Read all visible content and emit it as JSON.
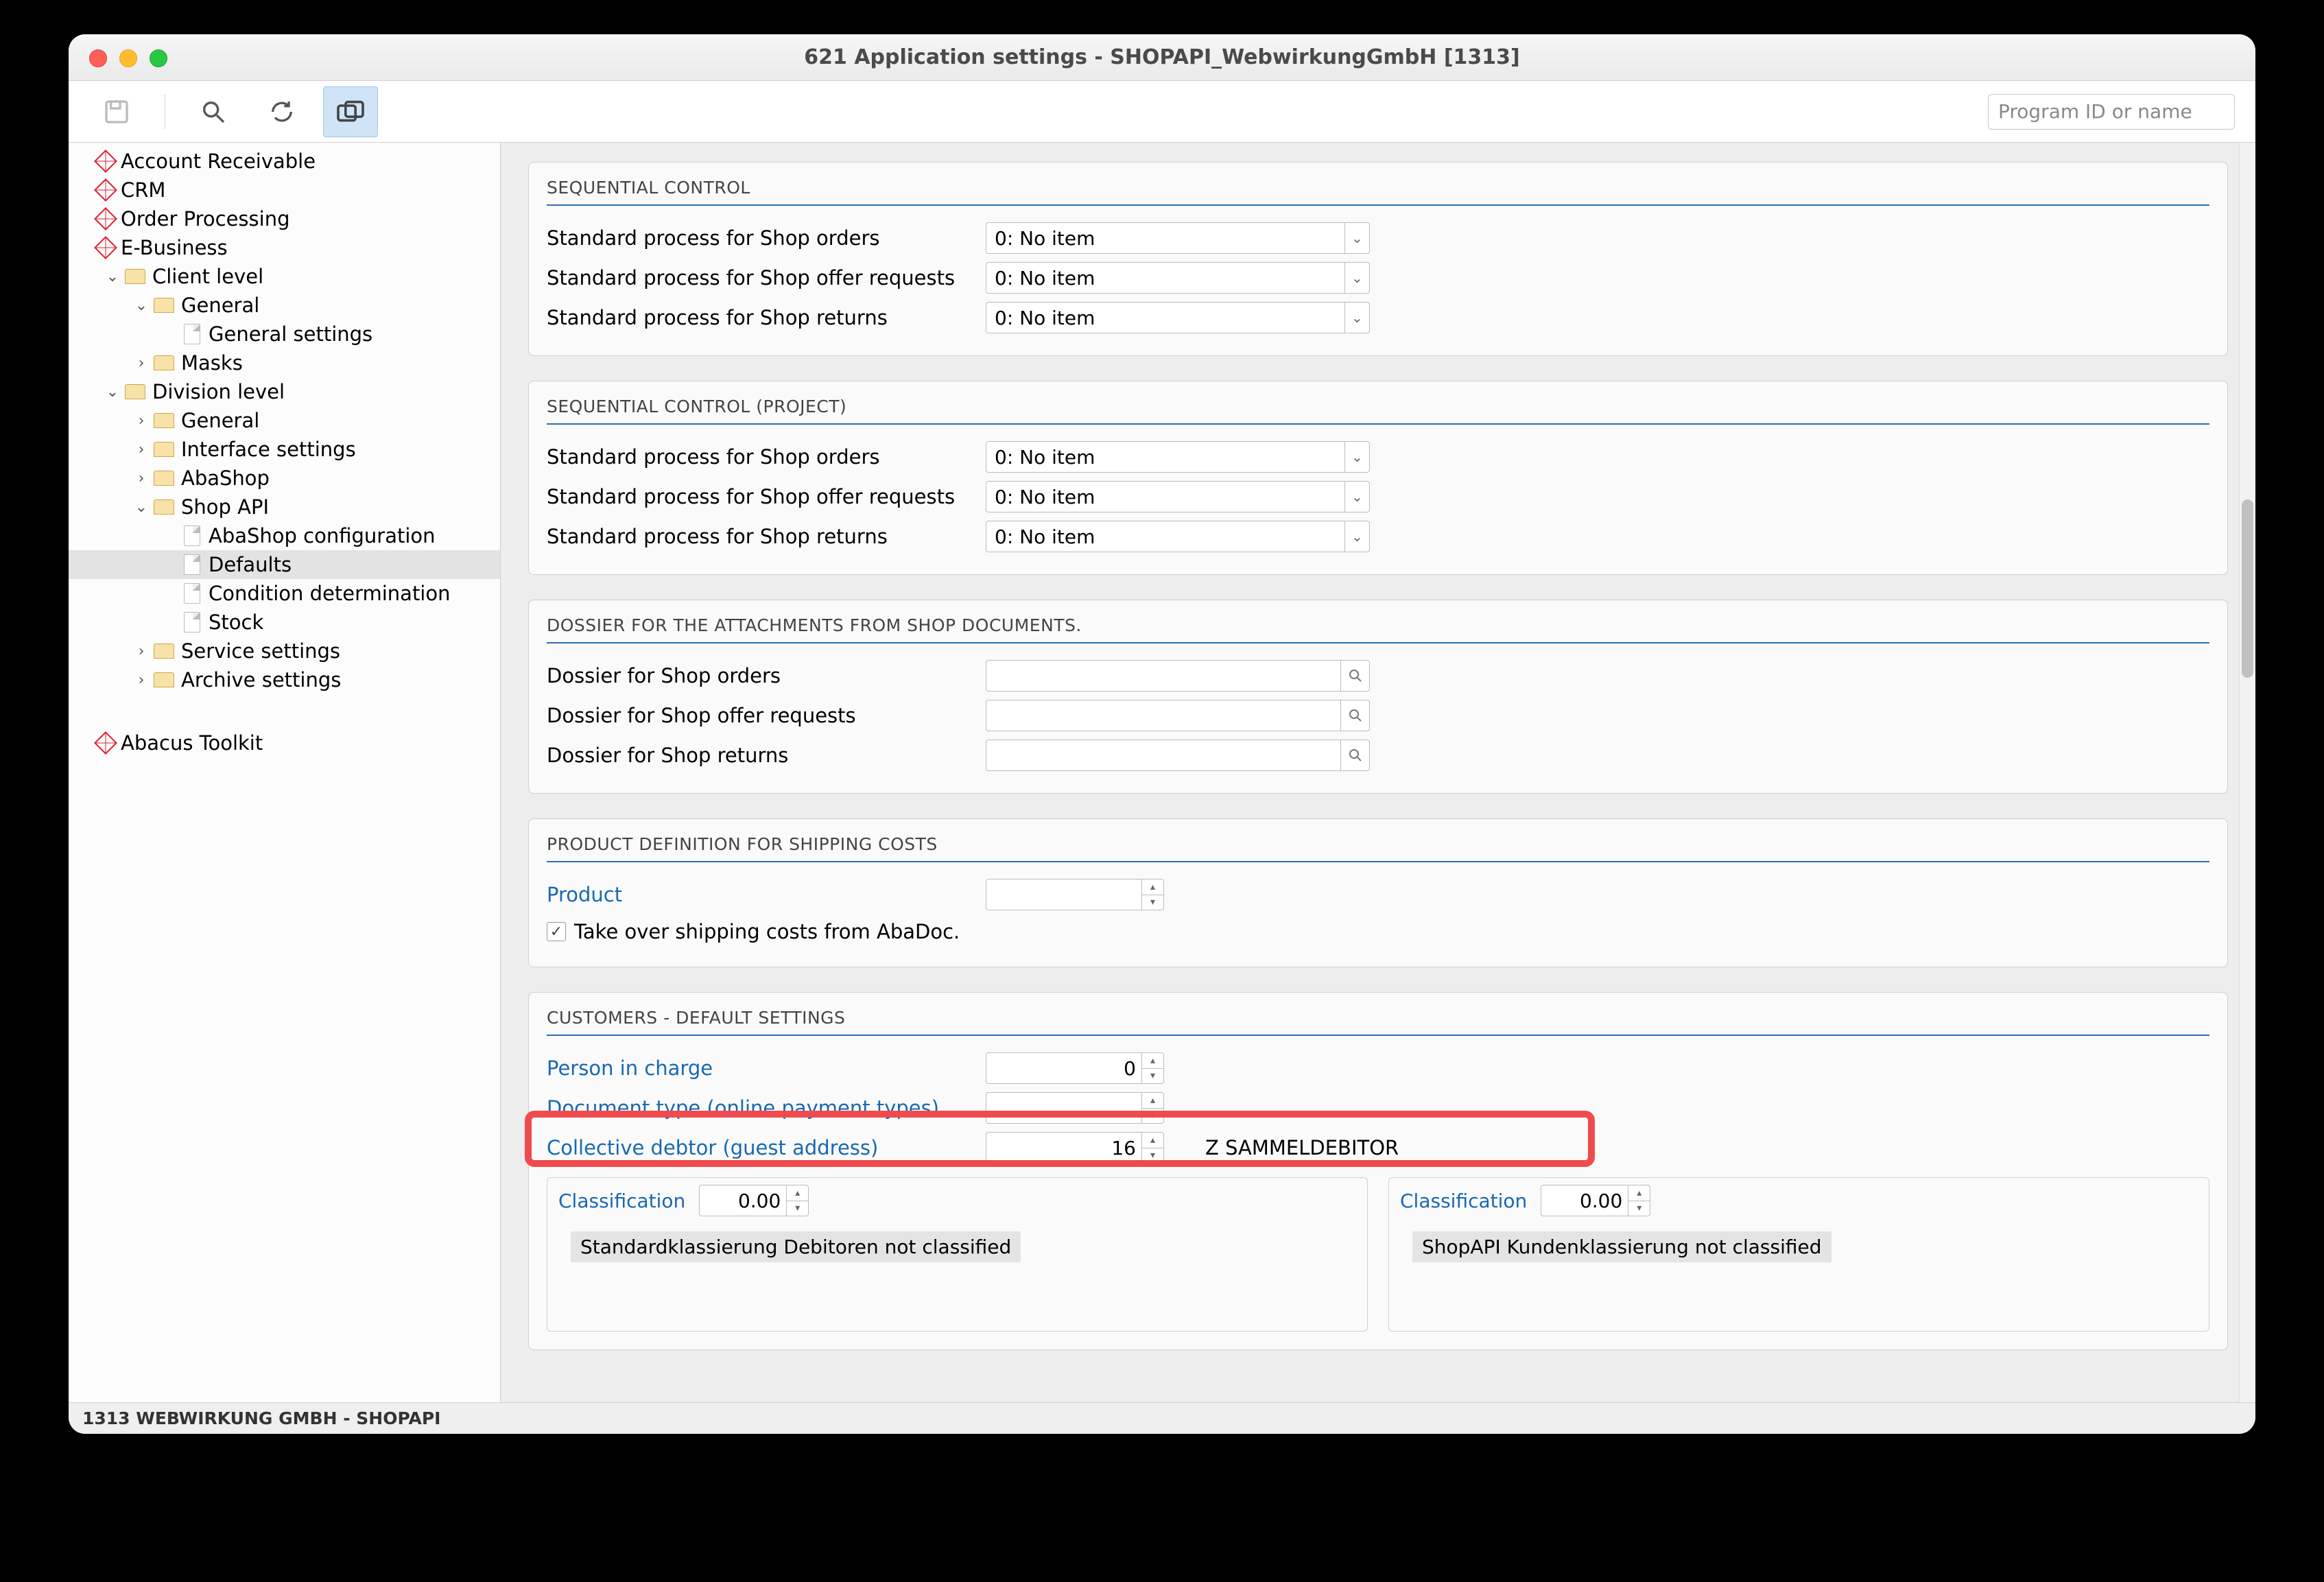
{
  "window": {
    "title": "621 Application settings - SHOPAPI_WebwirkungGmbH [1313]"
  },
  "toolbar": {
    "search_placeholder": "Program ID or name"
  },
  "sidebar": {
    "top": [
      {
        "label": "Account Receivable"
      },
      {
        "label": "CRM"
      },
      {
        "label": "Order Processing"
      },
      {
        "label": "E-Business"
      }
    ],
    "client_level": "Client level",
    "general": "General",
    "general_settings": "General settings",
    "masks": "Masks",
    "division_level": "Division level",
    "dl_general": "General",
    "interface_settings": "Interface settings",
    "abashop": "AbaShop",
    "shop_api": "Shop API",
    "abashop_config": "AbaShop configuration",
    "defaults": "Defaults",
    "condition_det": "Condition determination",
    "stock": "Stock",
    "service_settings": "Service settings",
    "archive_settings": "Archive settings",
    "abacus_toolkit": "Abacus Toolkit"
  },
  "panels": {
    "seq_control": "SEQUENTIAL CONTROL",
    "seq_orders": "Standard process for Shop orders",
    "seq_offers": "Standard process for Shop offer requests",
    "seq_returns": "Standard process for Shop returns",
    "no_item": "0: No item",
    "seq_project": "SEQUENTIAL CONTROL (PROJECT)",
    "dossier_header": "DOSSIER FOR THE ATTACHMENTS FROM SHOP DOCUMENTS.",
    "dossier_orders": "Dossier for Shop orders",
    "dossier_offers": "Dossier for Shop offer requests",
    "dossier_returns": "Dossier for Shop returns",
    "product_header": "PRODUCT DEFINITION FOR SHIPPING COSTS",
    "product_label": "Product",
    "take_over": "Take over shipping costs from AbaDoc.",
    "customers_header": "CUSTOMERS - DEFAULT SETTINGS",
    "person_in_charge": "Person in charge",
    "person_value": "0",
    "doc_type": "Document type (online payment types)",
    "collective_debtor": "Collective debtor (guest address)",
    "collective_value": "16",
    "collective_name": "Z SAMMELDEBITOR",
    "classification": "Classification",
    "class_val": "0.00",
    "class_left": "Standardklassierung Debitoren not classified",
    "class_right": "ShopAPI Kundenklassierung not classified"
  },
  "statusbar": "1313 WEBWIRKUNG GMBH - SHOPAPI"
}
